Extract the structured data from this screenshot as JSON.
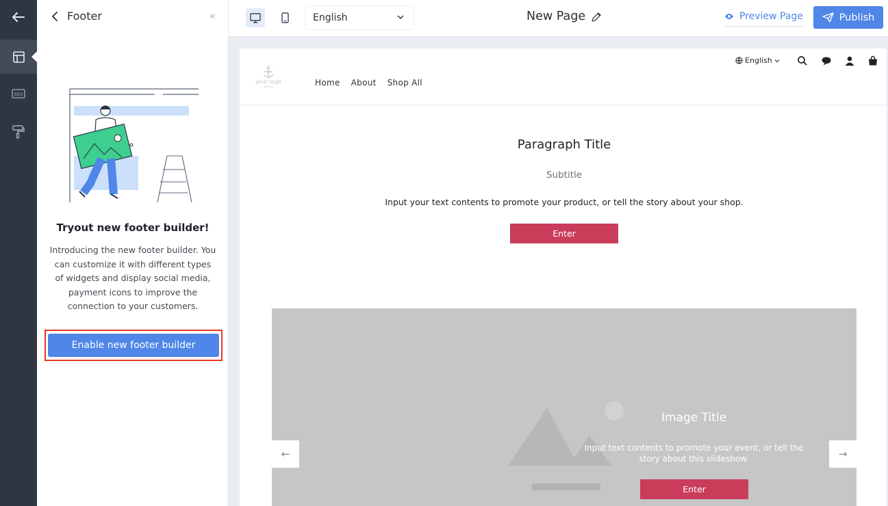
{
  "panel": {
    "title": "Footer",
    "collapse_glyph": "«",
    "promo_title": "Tryout new footer builder!",
    "promo_desc": "Introducing the new footer builder. You can customize it with different types of widgets and display social media, payment icons to improve the connection to your customers.",
    "enable_label": "Enable new footer builder"
  },
  "rail": {
    "icons": [
      "arrow-left-icon",
      "layout-icon",
      "seo-icon",
      "paint-roller-icon"
    ],
    "active_icon": "layout-icon"
  },
  "topbar": {
    "language": "English",
    "page_name": "New Page",
    "preview_label": "Preview Page",
    "publish_label": "Publish",
    "selected_device": "desktop"
  },
  "site": {
    "logo_text": "your logo",
    "nav": [
      "Home",
      "About",
      "Shop All"
    ],
    "language": "English"
  },
  "paragraph": {
    "title": "Paragraph Title",
    "subtitle": "Subtitle",
    "text": "Input your text contents to promote your product, or tell the story about your shop.",
    "button": "Enter"
  },
  "slideshow": {
    "title": "Image Title",
    "text": "Input text contents to promote your event, or tell the story about this slideshow.",
    "button": "Enter",
    "prev_glyph": "←",
    "next_glyph": "→"
  },
  "colors": {
    "accent": "#4f86e8",
    "rail": "#2f3541",
    "cta": "#c93d5b",
    "highlight": "#e8371f"
  }
}
